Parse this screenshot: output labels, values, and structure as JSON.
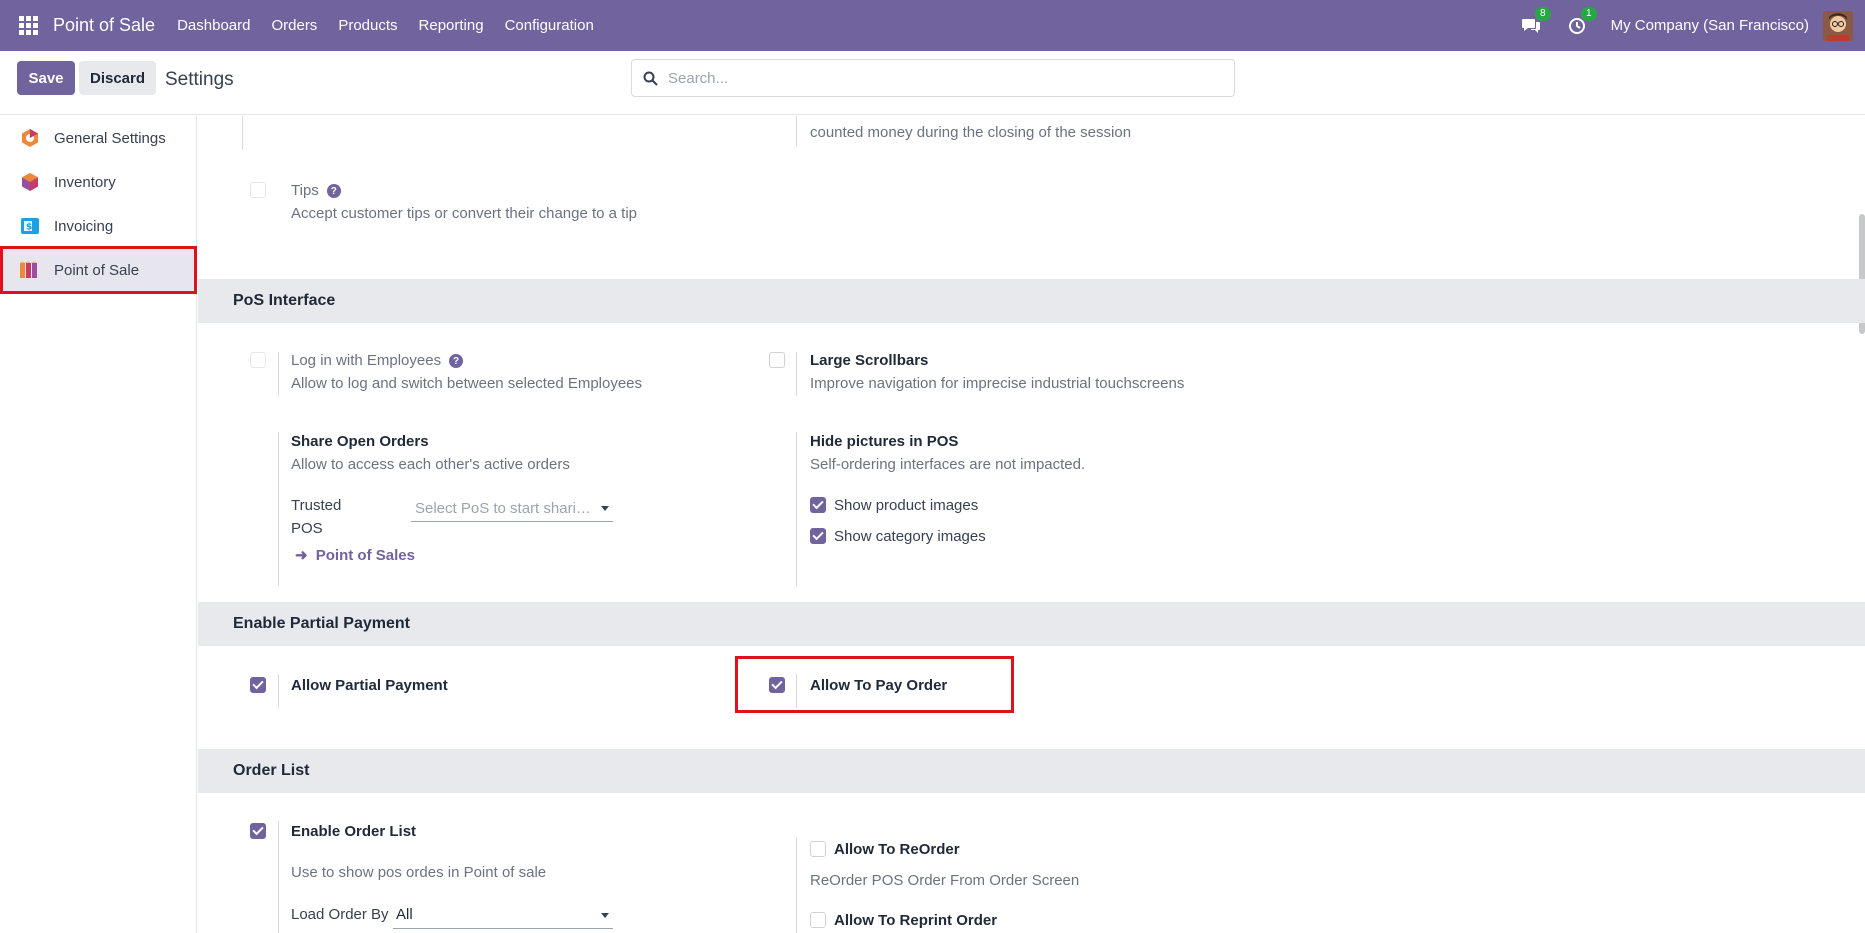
{
  "navbar": {
    "app_name": "Point of Sale",
    "menu": [
      "Dashboard",
      "Orders",
      "Products",
      "Reporting",
      "Configuration"
    ],
    "messages_count": "8",
    "activities_count": "1",
    "company": "My Company (San Francisco)"
  },
  "control": {
    "save_label": "Save",
    "discard_label": "Discard",
    "title": "Settings",
    "search_placeholder": "Search..."
  },
  "sidebar": {
    "items": [
      {
        "label": "General Settings",
        "icon": "general-settings-icon"
      },
      {
        "label": "Inventory",
        "icon": "inventory-icon"
      },
      {
        "label": "Invoicing",
        "icon": "invoicing-icon"
      },
      {
        "label": "Point of Sale",
        "icon": "point-of-sale-icon",
        "active": true
      }
    ]
  },
  "content": {
    "top_partial_desc": "counted money during the closing of the session",
    "tips": {
      "label": "Tips",
      "desc": "Accept customer tips or convert their change to a tip",
      "checked": false
    },
    "pos_interface": {
      "title": "PoS Interface",
      "login_employees": {
        "label": "Log in with Employees",
        "desc": "Allow to log and switch between selected Employees",
        "checked": false
      },
      "large_scrollbars": {
        "label": "Large Scrollbars",
        "desc": "Improve navigation for imprecise industrial touchscreens",
        "checked": false
      },
      "share_open_orders": {
        "label": "Share Open Orders",
        "desc": "Allow to access each other's active orders"
      },
      "trusted_pos_label_1": "Trusted",
      "trusted_pos_label_2": "POS",
      "trusted_pos_placeholder": "Select PoS to start shari…",
      "point_of_sales_link": "Point of Sales",
      "hide_pictures": {
        "label": "Hide pictures in POS",
        "desc": "Self-ordering interfaces are not impacted."
      },
      "show_product_images": {
        "label": "Show product images",
        "checked": true
      },
      "show_category_images": {
        "label": "Show category images",
        "checked": true
      }
    },
    "partial_payment": {
      "title": "Enable Partial Payment",
      "allow_partial_payment": {
        "label": "Allow Partial Payment",
        "checked": true
      },
      "allow_to_pay_order": {
        "label": "Allow To Pay Order",
        "checked": true
      }
    },
    "order_list": {
      "title": "Order List",
      "enable_order_list": {
        "label": "Enable Order List",
        "desc": "Use to show pos ordes in Point of sale",
        "checked": true
      },
      "load_order_by_label": "Load Order By",
      "load_order_by_value": "All",
      "allow_reorder": {
        "label": "Allow To ReOrder",
        "desc": "ReOrder POS Order From Order Screen",
        "checked": false
      },
      "allow_reprint": {
        "label": "Allow To Reprint Order",
        "checked": false
      }
    }
  },
  "colors": {
    "brand": "#71639e",
    "highlight": "#e0101d",
    "badge": "#28a745"
  }
}
